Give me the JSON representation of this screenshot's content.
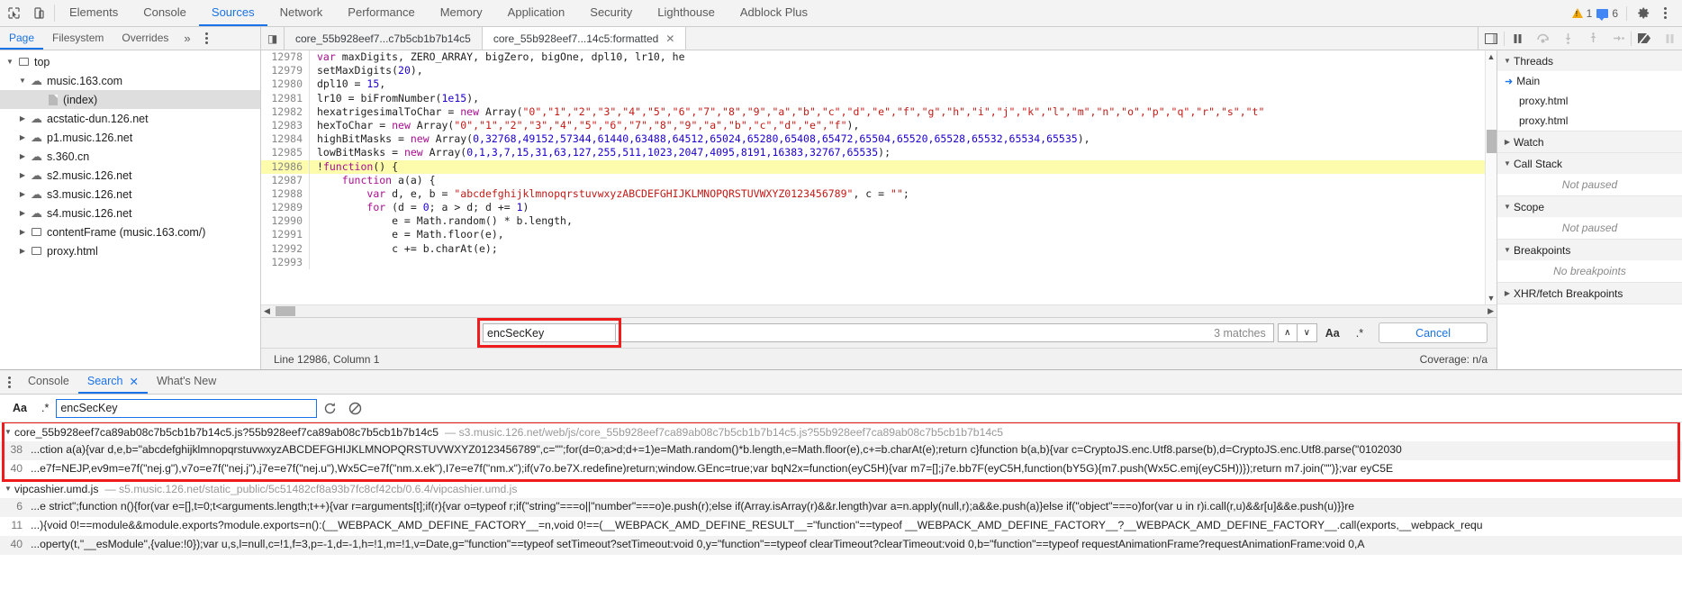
{
  "toolbar": {
    "icons": [
      {
        "name": "inspect-element-icon",
        "glyph": "⬚"
      },
      {
        "name": "device-toolbar-icon",
        "glyph": "▭"
      }
    ],
    "panels": [
      {
        "label": "Elements",
        "active": false
      },
      {
        "label": "Console",
        "active": false
      },
      {
        "label": "Sources",
        "active": true
      },
      {
        "label": "Network",
        "active": false
      },
      {
        "label": "Performance",
        "active": false
      },
      {
        "label": "Memory",
        "active": false
      },
      {
        "label": "Application",
        "active": false
      },
      {
        "label": "Security",
        "active": false
      },
      {
        "label": "Lighthouse",
        "active": false
      },
      {
        "label": "Adblock Plus",
        "active": false
      }
    ],
    "warning_count": "1",
    "message_count": "6",
    "settings_label": "⚙",
    "more_label": "⋮"
  },
  "navigator": {
    "tabs": [
      {
        "label": "Page",
        "active": true
      },
      {
        "label": "Filesystem",
        "active": false
      },
      {
        "label": "Overrides",
        "active": false
      }
    ],
    "more_label": "»",
    "tree": [
      {
        "label": "top",
        "icon": "frame-icon",
        "indent": 0,
        "twisty": "▼",
        "selected": false
      },
      {
        "label": "music.163.com",
        "icon": "cloud-icon",
        "indent": 1,
        "twisty": "▼",
        "selected": false
      },
      {
        "label": "(index)",
        "icon": "document-icon",
        "indent": 2,
        "twisty": "",
        "selected": true
      },
      {
        "label": "acstatic-dun.126.net",
        "icon": "cloud-icon",
        "indent": 1,
        "twisty": "▶",
        "selected": false
      },
      {
        "label": "p1.music.126.net",
        "icon": "cloud-icon",
        "indent": 1,
        "twisty": "▶",
        "selected": false
      },
      {
        "label": "s.360.cn",
        "icon": "cloud-icon",
        "indent": 1,
        "twisty": "▶",
        "selected": false
      },
      {
        "label": "s2.music.126.net",
        "icon": "cloud-icon",
        "indent": 1,
        "twisty": "▶",
        "selected": false
      },
      {
        "label": "s3.music.126.net",
        "icon": "cloud-icon",
        "indent": 1,
        "twisty": "▶",
        "selected": false
      },
      {
        "label": "s4.music.126.net",
        "icon": "cloud-icon",
        "indent": 1,
        "twisty": "▶",
        "selected": false
      },
      {
        "label": "contentFrame (music.163.com/)",
        "icon": "frame-icon",
        "indent": 1,
        "twisty": "▶",
        "selected": false
      },
      {
        "label": "proxy.html",
        "icon": "frame-icon",
        "indent": 1,
        "twisty": "▶",
        "selected": false
      }
    ]
  },
  "editor": {
    "back_icon": "◁",
    "tabs": [
      {
        "label": "core_55b928eef7...c7b5cb1b7b14c5",
        "active": false,
        "closable": false
      },
      {
        "label": "core_55b928eef7...14c5:formatted",
        "active": true,
        "closable": true,
        "close_label": "✕"
      }
    ],
    "debug_buttons": [
      {
        "name": "pause-resume-button",
        "glyph": "⏸"
      },
      {
        "name": "step-over-button",
        "glyph": "↷"
      },
      {
        "name": "step-into-button",
        "glyph": "↓"
      },
      {
        "name": "step-out-button",
        "glyph": "↑"
      },
      {
        "name": "step-button",
        "glyph": "→"
      },
      {
        "name": "deactivate-breakpoints-button",
        "glyph": "⦸"
      },
      {
        "name": "pause-on-exceptions-button",
        "glyph": "⏸"
      }
    ],
    "show_navigator_icon": "◨"
  },
  "code": {
    "lines": [
      {
        "no": "12978",
        "highlight": false,
        "partial": true,
        "tokens": [
          {
            "t": "var ",
            "c": "kw"
          },
          {
            "t": "maxDigits, ZERO_ARRAY, bigZero, bigOne, dpl10, lr10, he",
            "c": "pl"
          }
        ]
      },
      {
        "no": "12979",
        "highlight": false,
        "tokens": [
          {
            "t": "setMaxDigits(",
            "c": "pl"
          },
          {
            "t": "20",
            "c": "num"
          },
          {
            "t": "),",
            "c": "pl"
          }
        ]
      },
      {
        "no": "12980",
        "highlight": false,
        "tokens": [
          {
            "t": "dpl10 = ",
            "c": "pl"
          },
          {
            "t": "15",
            "c": "num"
          },
          {
            "t": ",",
            "c": "pl"
          }
        ]
      },
      {
        "no": "12981",
        "highlight": false,
        "tokens": [
          {
            "t": "lr10 = biFromNumber(",
            "c": "pl"
          },
          {
            "t": "1e15",
            "c": "num"
          },
          {
            "t": "),",
            "c": "pl"
          }
        ]
      },
      {
        "no": "12982",
        "highlight": false,
        "tokens": [
          {
            "t": "hexatrigesimalToChar = ",
            "c": "pl"
          },
          {
            "t": "new ",
            "c": "kw"
          },
          {
            "t": "Array(",
            "c": "pl"
          },
          {
            "t": "\"0\",\"1\",\"2\",\"3\",\"4\",\"5\",\"6\",\"7\",\"8\",\"9\",\"a\",\"b\",\"c\",\"d\",\"e\",\"f\",\"g\",\"h\",\"i\",\"j\",\"k\",\"l\",\"m\",\"n\",\"o\",\"p\",\"q\",\"r\",\"s\",\"t\"",
            "c": "str"
          }
        ]
      },
      {
        "no": "12983",
        "highlight": false,
        "tokens": [
          {
            "t": "hexToChar = ",
            "c": "pl"
          },
          {
            "t": "new ",
            "c": "kw"
          },
          {
            "t": "Array(",
            "c": "pl"
          },
          {
            "t": "\"0\",\"1\",\"2\",\"3\",\"4\",\"5\",\"6\",\"7\",\"8\",\"9\",\"a\",\"b\",\"c\",\"d\",\"e\",\"f\"",
            "c": "str"
          },
          {
            "t": "),",
            "c": "pl"
          }
        ]
      },
      {
        "no": "12984",
        "highlight": false,
        "tokens": [
          {
            "t": "highBitMasks = ",
            "c": "pl"
          },
          {
            "t": "new ",
            "c": "kw"
          },
          {
            "t": "Array(",
            "c": "pl"
          },
          {
            "t": "0,32768,49152,57344,61440,63488,64512,65024,65280,65408,65472,65504,65520,65528,65532,65534,65535",
            "c": "num"
          },
          {
            "t": "),",
            "c": "pl"
          }
        ]
      },
      {
        "no": "12985",
        "highlight": false,
        "tokens": [
          {
            "t": "lowBitMasks = ",
            "c": "pl"
          },
          {
            "t": "new ",
            "c": "kw"
          },
          {
            "t": "Array(",
            "c": "pl"
          },
          {
            "t": "0,1,3,7,15,31,63,127,255,511,1023,2047,4095,8191,16383,32767,65535",
            "c": "num"
          },
          {
            "t": ");",
            "c": "pl"
          }
        ]
      },
      {
        "no": "12986",
        "highlight": true,
        "tokens": [
          {
            "t": "!",
            "c": "pl"
          },
          {
            "t": "function",
            "c": "kw"
          },
          {
            "t": "() {",
            "c": "pl"
          }
        ]
      },
      {
        "no": "12987",
        "highlight": false,
        "tokens": [
          {
            "t": "    ",
            "c": "pl"
          },
          {
            "t": "function ",
            "c": "kw"
          },
          {
            "t": "a(a) {",
            "c": "pl"
          }
        ]
      },
      {
        "no": "12988",
        "highlight": false,
        "tokens": [
          {
            "t": "        ",
            "c": "pl"
          },
          {
            "t": "var ",
            "c": "kw"
          },
          {
            "t": "d, e, b = ",
            "c": "pl"
          },
          {
            "t": "\"abcdefghijklmnopqrstuvwxyzABCDEFGHIJKLMNOPQRSTUVWXYZ0123456789\"",
            "c": "str"
          },
          {
            "t": ", c = ",
            "c": "pl"
          },
          {
            "t": "\"\"",
            "c": "str"
          },
          {
            "t": ";",
            "c": "pl"
          }
        ]
      },
      {
        "no": "12989",
        "highlight": false,
        "tokens": [
          {
            "t": "        ",
            "c": "pl"
          },
          {
            "t": "for ",
            "c": "kw"
          },
          {
            "t": "(d = ",
            "c": "pl"
          },
          {
            "t": "0",
            "c": "num"
          },
          {
            "t": "; a > d; d += ",
            "c": "pl"
          },
          {
            "t": "1",
            "c": "num"
          },
          {
            "t": ")",
            "c": "pl"
          }
        ]
      },
      {
        "no": "12990",
        "highlight": false,
        "tokens": [
          {
            "t": "            e = Math.random() * b.length,",
            "c": "pl"
          }
        ]
      },
      {
        "no": "12991",
        "highlight": false,
        "tokens": [
          {
            "t": "            e = Math.floor(e),",
            "c": "pl"
          }
        ]
      },
      {
        "no": "12992",
        "highlight": false,
        "tokens": [
          {
            "t": "            c += b.charAt(e);",
            "c": "pl"
          }
        ]
      },
      {
        "no": "12993",
        "highlight": false,
        "tokens": [
          {
            "t": "",
            "c": "pl"
          }
        ]
      }
    ]
  },
  "find": {
    "query": "encSecKey",
    "matches_label": "3 matches",
    "prev_label": "∧",
    "next_label": "∨",
    "match_case_label": "Aa",
    "regex_label": ".*",
    "cancel_label": "Cancel",
    "highlight_color": "#ee1c1c"
  },
  "status": {
    "cursor": "Line 12986, Column 1",
    "coverage": "Coverage: n/a"
  },
  "sidebar": {
    "sections": [
      {
        "title": "Threads",
        "twisty": "▼",
        "items": [
          {
            "label": "Main",
            "current": true,
            "arrow": "➜"
          },
          {
            "label": "proxy.html",
            "current": false,
            "arrow": ""
          },
          {
            "label": "proxy.html",
            "current": false,
            "arrow": ""
          }
        ],
        "empty": ""
      },
      {
        "title": "Watch",
        "twisty": "▶",
        "items": [],
        "empty": ""
      },
      {
        "title": "Call Stack",
        "twisty": "▼",
        "items": [],
        "empty": "Not paused"
      },
      {
        "title": "Scope",
        "twisty": "▼",
        "items": [],
        "empty": "Not paused"
      },
      {
        "title": "Breakpoints",
        "twisty": "▼",
        "items": [],
        "empty": "No breakpoints"
      },
      {
        "title": "XHR/fetch Breakpoints",
        "twisty": "▶",
        "items": [],
        "empty": ""
      }
    ]
  },
  "drawer": {
    "menu_label": "⋮",
    "tabs": [
      {
        "label": "Console",
        "active": false,
        "close_label": ""
      },
      {
        "label": "Search",
        "active": true,
        "close_label": "✕"
      },
      {
        "label": "What's New",
        "active": false,
        "close_label": ""
      }
    ],
    "search": {
      "match_case_label": "Aa",
      "regex_label": ".*",
      "query": "encSecKey",
      "placeholder": "",
      "refresh_label": "↻",
      "clear_label": "⦸"
    },
    "results": [
      {
        "file": "core_55b928eef7ca89ab08c7b5cb1b7b14c5.js?55b928eef7ca89ab08c7b5cb1b7b14c5",
        "url": "s3.music.126.net/web/js/core_55b928eef7ca89ab08c7b5cb1b7b14c5.js?55b928eef7ca89ab08c7b5cb1b7b14c5",
        "twisty": "▼",
        "matches": [
          {
            "no": "38",
            "text": "...ction a(a){var d,e,b=\"abcdefghijklmnopqrstuvwxyzABCDEFGHIJKLMNOPQRSTUVWXYZ0123456789\",c=\"\";for(d=0;a>d;d+=1)e=Math.random()*b.length,e=Math.floor(e),c+=b.charAt(e);return c}function b(a,b){var c=CryptoJS.enc.Utf8.parse(b),d=CryptoJS.enc.Utf8.parse(\"0102030"
          },
          {
            "no": "40",
            "text": "...e7f=NEJP,ev9m=e7f(\"nej.g\"),v7o=e7f(\"nej.j\"),j7e=e7f(\"nej.u\"),Wx5C=e7f(\"nm.x.ek\"),I7e=e7f(\"nm.x\");if(v7o.be7X.redefine)return;window.GEnc=true;var bqN2x=function(eyC5H){var m7=[];j7e.bb7F(eyC5H,function(bY5G){m7.push(Wx5C.emj(eyC5H))});return m7.join(\"\")};var eyC5E"
          }
        ]
      },
      {
        "file": "vipcashier.umd.js",
        "url": "s5.music.126.net/static_public/5c51482cf8a93b7fc8cf42cb/0.6.4/vipcashier.umd.js",
        "twisty": "▼",
        "matches": [
          {
            "no": "6",
            "text": "...e strict\";function n(){for(var e=[],t=0;t<arguments.length;t++){var r=arguments[t];if(r){var o=typeof r;if(\"string\"===o||\"number\"===o)e.push(r);else if(Array.isArray(r)&&r.length)var a=n.apply(null,r);a&&e.push(a)}else if(\"object\"===o)for(var u in r)i.call(r,u)&&r[u]&&e.push(u)}}re"
          },
          {
            "no": "11",
            "text": "...){void 0!==module&&module.exports?module.exports=n():(__WEBPACK_AMD_DEFINE_FACTORY__=n,void 0!==(__WEBPACK_AMD_DEFINE_RESULT__=\"function\"==typeof __WEBPACK_AMD_DEFINE_FACTORY__?__WEBPACK_AMD_DEFINE_FACTORY__.call(exports,__webpack_requ"
          },
          {
            "no": "40",
            "text": "...operty(t,\"__esModule\",{value:!0});var u,s,l=null,c=!1,f=3,p=-1,d=-1,h=!1,m=!1,v=Date,g=\"function\"==typeof setTimeout?setTimeout:void 0,y=\"function\"==typeof clearTimeout?clearTimeout:void 0,b=\"function\"==typeof requestAnimationFrame?requestAnimationFrame:void 0,A"
          }
        ]
      }
    ]
  }
}
